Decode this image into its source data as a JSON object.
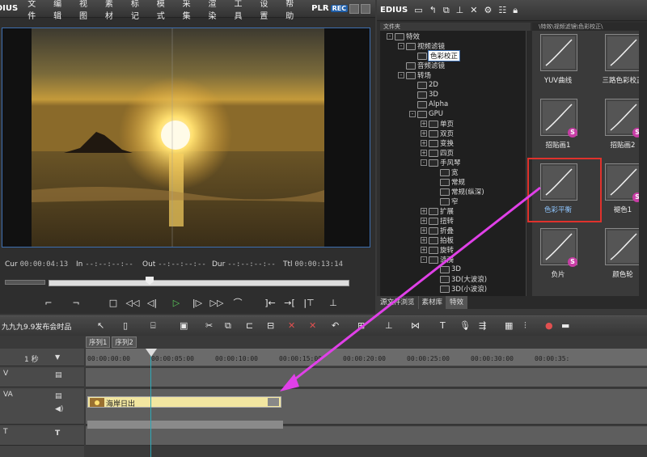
{
  "player": {
    "logo": "EDIUS",
    "menu": [
      "文件",
      "编辑",
      "视图",
      "素材",
      "标记",
      "模式",
      "采集",
      "渲染",
      "工具",
      "设置",
      "帮助"
    ],
    "plr_label": "PLR",
    "rec_label": "REC",
    "timecodes": {
      "cur_label": "Cur",
      "cur_value": "00:00:04:13",
      "in_label": "In",
      "in_value": "--:--:--:--",
      "out_label": "Out",
      "out_value": "--:--:--:--",
      "dur_label": "Dur",
      "dur_value": "--:--:--:--",
      "ttl_label": "Ttl",
      "ttl_value": "00:00:13:14"
    }
  },
  "effects": {
    "title": "EDIUS",
    "tree_header": "文件夹",
    "tree": [
      {
        "label": "特效",
        "depth": 0,
        "exp": "-"
      },
      {
        "label": "视频滤镜",
        "depth": 1,
        "exp": "-"
      },
      {
        "label": "色彩校正",
        "depth": 2,
        "exp": "",
        "selected": true
      },
      {
        "label": "音频滤镜",
        "depth": 1,
        "exp": ""
      },
      {
        "label": "转场",
        "depth": 1,
        "exp": "-"
      },
      {
        "label": "2D",
        "depth": 2,
        "exp": ""
      },
      {
        "label": "3D",
        "depth": 2,
        "exp": ""
      },
      {
        "label": "Alpha",
        "depth": 2,
        "exp": ""
      },
      {
        "label": "GPU",
        "depth": 2,
        "exp": "-"
      },
      {
        "label": "单页",
        "depth": 3,
        "exp": "+"
      },
      {
        "label": "双页",
        "depth": 3,
        "exp": "+"
      },
      {
        "label": "变换",
        "depth": 3,
        "exp": "+"
      },
      {
        "label": "四页",
        "depth": 3,
        "exp": "+"
      },
      {
        "label": "手风琴",
        "depth": 3,
        "exp": "-"
      },
      {
        "label": "宽",
        "depth": 4,
        "exp": ""
      },
      {
        "label": "常规",
        "depth": 4,
        "exp": ""
      },
      {
        "label": "常规(纵深)",
        "depth": 4,
        "exp": ""
      },
      {
        "label": "窄",
        "depth": 4,
        "exp": ""
      },
      {
        "label": "扩展",
        "depth": 3,
        "exp": "+"
      },
      {
        "label": "扭转",
        "depth": 3,
        "exp": "+"
      },
      {
        "label": "折叠",
        "depth": 3,
        "exp": "+"
      },
      {
        "label": "拍板",
        "depth": 3,
        "exp": "+"
      },
      {
        "label": "旋转",
        "depth": 3,
        "exp": "+"
      },
      {
        "label": "涟漪",
        "depth": 3,
        "exp": "-"
      },
      {
        "label": "3D",
        "depth": 4,
        "exp": ""
      },
      {
        "label": "3D(大波浪)",
        "depth": 4,
        "exp": ""
      },
      {
        "label": "3D(小波浪)",
        "depth": 4,
        "exp": ""
      }
    ],
    "grid_path": "\\特效\\视频滤镜\\色彩校正\\",
    "items": [
      {
        "name": "YUV曲线",
        "badge": ""
      },
      {
        "name": "三路色彩校正",
        "badge": ""
      },
      {
        "name": "招贴画1",
        "badge": "S"
      },
      {
        "name": "招贴画2",
        "badge": "S"
      },
      {
        "name": "色彩平衡",
        "badge": "",
        "highlighted": true
      },
      {
        "name": "褪色1",
        "badge": "S"
      },
      {
        "name": "负片",
        "badge": "S"
      },
      {
        "name": "颜色轮",
        "badge": ""
      }
    ],
    "tabs": [
      "源文件浏览",
      "素材库",
      "特效"
    ]
  },
  "timeline": {
    "project_name": "九九九9.9发布会时品",
    "sequences": [
      "序列1",
      "序列2"
    ],
    "zoom": "1 秒",
    "ruler": [
      "00:00:00:00",
      "00:00:05:00",
      "00:00:10:00",
      "00:00:15:00",
      "00:00:20:00",
      "00:00:25:00",
      "00:00:30:00",
      "00:00:35:"
    ],
    "tracks": [
      "V",
      "VA",
      "T"
    ],
    "clip_name": "海岸日出",
    "colors": {
      "clip": "#f2e6a0",
      "playhead": "#2ea9b8",
      "highlight": "#e0322c",
      "arrow": "#e040e8"
    }
  }
}
